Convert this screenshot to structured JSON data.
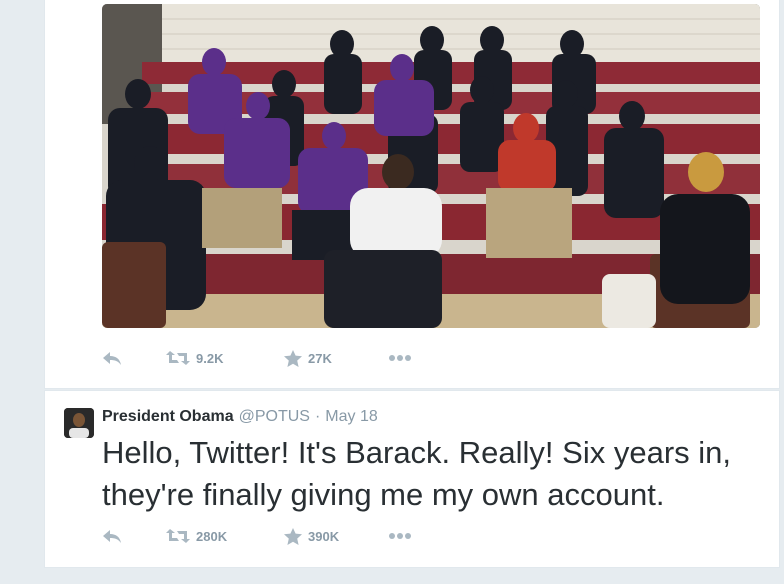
{
  "tweet_top": {
    "photo_alt": "",
    "actions": {
      "reply_icon": "reply-icon",
      "retweet_icon": "retweet-icon",
      "retweet_count": "9.2K",
      "favorite_icon": "star-icon",
      "favorite_count": "27K",
      "more_icon": "more-icon"
    }
  },
  "tweet_main": {
    "name": "President Obama",
    "handle": "@POTUS",
    "separator": "·",
    "time": "May 18",
    "text": "Hello, Twitter! It's Barack. Really! Six years in, they're finally giving me my own account.",
    "actions": {
      "reply_icon": "reply-icon",
      "retweet_icon": "retweet-icon",
      "retweet_count": "280K",
      "favorite_icon": "star-icon",
      "favorite_count": "390K",
      "more_icon": "more-icon"
    }
  },
  "colors": {
    "background": "#e6ecf0",
    "text": "#292f33",
    "muted": "#8899a6",
    "icon": "#aab8c2"
  }
}
